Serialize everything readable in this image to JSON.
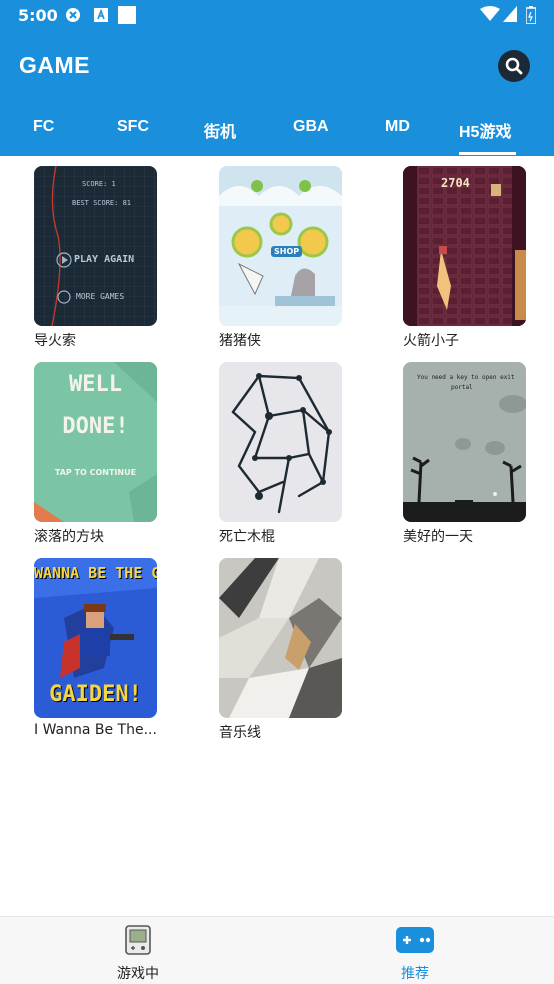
{
  "status_bar": {
    "time": "5:00"
  },
  "header": {
    "title": "GAME"
  },
  "tabs": [
    {
      "label": "FC"
    },
    {
      "label": "SFC"
    },
    {
      "label": "街机"
    },
    {
      "label": "GBA"
    },
    {
      "label": "MD"
    },
    {
      "label": "H5游戏",
      "selected": true
    }
  ],
  "games": [
    {
      "name": "导火索",
      "thumb_text": [
        "SCORE: 1",
        "BEST SCORE: 81",
        "PLAY AGAIN",
        "MORE GAMES"
      ]
    },
    {
      "name": "猪猪侠",
      "thumb_text": [
        "SHOP"
      ]
    },
    {
      "name": "火箭小子",
      "thumb_text": [
        "2704"
      ]
    },
    {
      "name": "滚落的方块",
      "thumb_text": [
        "WELL",
        "DONE!",
        "TAP TO CONTINUE"
      ]
    },
    {
      "name": "死亡木棍",
      "thumb_text": []
    },
    {
      "name": "美好的一天",
      "thumb_text": [
        "You need a key to open exit",
        "portal"
      ]
    },
    {
      "name": "I Wanna Be The...",
      "thumb_text": [
        "WANNA BE THE GU",
        "GAIDEN!"
      ]
    },
    {
      "name": "音乐线",
      "thumb_text": []
    }
  ],
  "bottom_nav": [
    {
      "label": "游戏中",
      "icon": "gameboy-icon"
    },
    {
      "label": "推荐",
      "icon": "gamepad-icon",
      "active": true
    }
  ],
  "colors": {
    "primary": "#1a8fdb",
    "active_nav": "#1a8fdb",
    "text": "#222222"
  }
}
